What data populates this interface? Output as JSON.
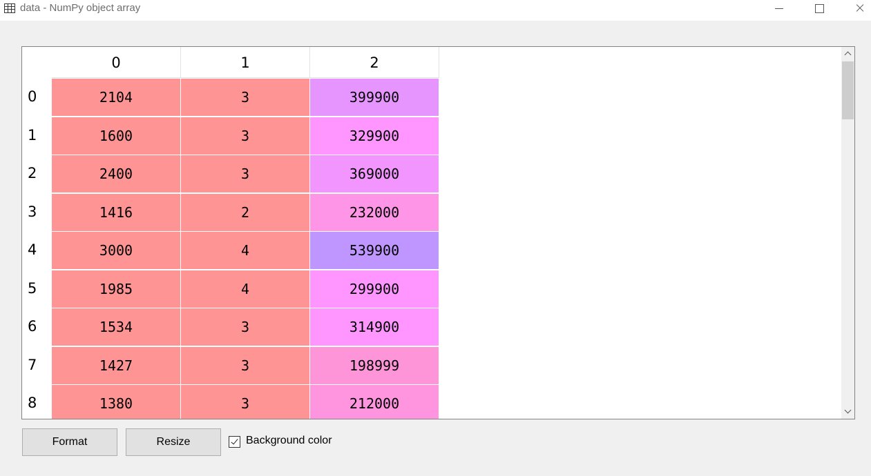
{
  "window": {
    "title": "data - NumPy object array",
    "icon": "table-icon"
  },
  "table": {
    "columns": [
      "0",
      "1",
      "2"
    ],
    "rows": [
      "0",
      "1",
      "2",
      "3",
      "4",
      "5",
      "6",
      "7",
      "8"
    ],
    "cells": [
      [
        "2104",
        "3",
        "399900"
      ],
      [
        "1600",
        "3",
        "329900"
      ],
      [
        "2400",
        "3",
        "369000"
      ],
      [
        "1416",
        "2",
        "232000"
      ],
      [
        "3000",
        "4",
        "539900"
      ],
      [
        "1985",
        "4",
        "299900"
      ],
      [
        "1534",
        "3",
        "314900"
      ],
      [
        "1427",
        "3",
        "198999"
      ],
      [
        "1380",
        "3",
        "212000"
      ]
    ],
    "cell_colors": [
      [
        "#ff9494",
        "#ff9494",
        "#e695ff"
      ],
      [
        "#ff9494",
        "#ff9494",
        "#ff95ff"
      ],
      [
        "#ff9494",
        "#ff9494",
        "#f295ff"
      ],
      [
        "#ff9494",
        "#ff9494",
        "#ff95e6"
      ],
      [
        "#ff9494",
        "#ff9494",
        "#bf95ff"
      ],
      [
        "#ff9494",
        "#ff9494",
        "#ff95ff"
      ],
      [
        "#ff9494",
        "#ff9494",
        "#ff95ff"
      ],
      [
        "#ff9494",
        "#ff9494",
        "#ff95d9"
      ],
      [
        "#ff9494",
        "#ff9494",
        "#ff95df"
      ]
    ]
  },
  "buttons": {
    "format_label": "Format",
    "resize_label": "Resize"
  },
  "options": {
    "background_color_label": "Background color",
    "background_color_checked": true
  }
}
